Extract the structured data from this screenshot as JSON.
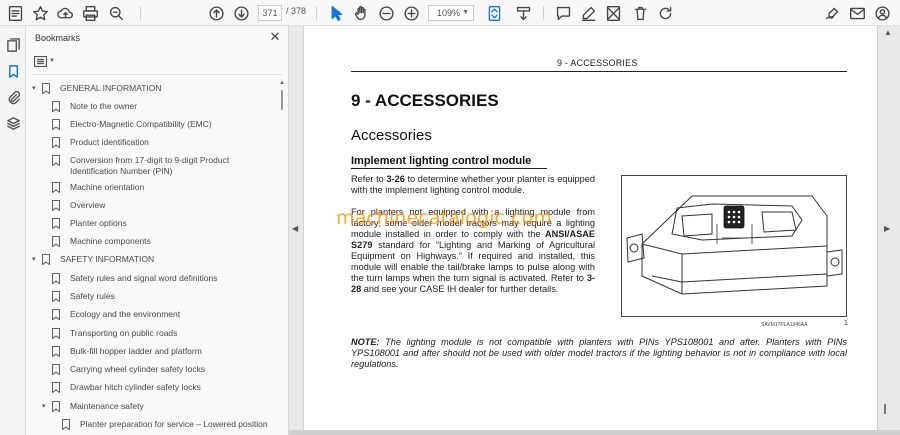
{
  "toolbar": {
    "page_current": "371",
    "page_total": "/ 378",
    "zoom": "109%"
  },
  "panel": {
    "title": "Bookmarks",
    "close": "✕",
    "items": [
      {
        "label": "GENERAL INFORMATION",
        "expanded": true
      },
      {
        "label": "Note to the owner"
      },
      {
        "label": "Electro-Magnetic Compatibility (EMC)"
      },
      {
        "label": "Product identification"
      },
      {
        "label": "Conversion from 17-digit to 9-digit Product Identification Number (PIN)"
      },
      {
        "label": "Machine orientation"
      },
      {
        "label": "Overview"
      },
      {
        "label": "Planter options"
      },
      {
        "label": "Machine components"
      },
      {
        "label": "SAFETY INFORMATION",
        "expanded": true
      },
      {
        "label": "Safety rules and signal word definitions"
      },
      {
        "label": "Safety rules"
      },
      {
        "label": "Ecology and the environment"
      },
      {
        "label": "Transporting on public roads"
      },
      {
        "label": "Bulk-fill hopper ladder and platform"
      },
      {
        "label": "Carrying wheel cylinder safety locks"
      },
      {
        "label": "Drawbar hitch cylinder safety locks"
      },
      {
        "label": "Maintenance safety",
        "expanded": true
      },
      {
        "label": "Planter preparation for service – Lowered position"
      }
    ]
  },
  "document": {
    "header": "9 - ACCESSORIES",
    "chapter_title": "9 - ACCESSORIES",
    "section_title": "Accessories",
    "subsection_title": "Implement lighting control module",
    "para1_a": "Refer to ",
    "para1_ref": "3-26",
    "para1_b": " to determine whether your planter is equipped with the implement lighting control module.",
    "para2_a": "For planters not equipped with a lighting module from factory, some older model tractors may require a lighting module installed in order to comply with the ",
    "para2_std": "ANSI/ASAE S279",
    "para2_b": " standard for “Lighting and Marking of Agricultural Equipment on Highways.” If required and installed, this module will enable the tail/brake lamps to pulse along with the turn lamps when the turn signal is activated. Refer to ",
    "para2_ref": "3-28",
    "para2_c": " and see your CASE IH dealer for further details.",
    "note_label": "NOTE:",
    "note_text": " The lighting module is not compatible with planters with PINs YPS108001 and after. Planters with PINs YPS108001 and after should not be used with older model tractors if the lighting behavior is not in compliance with local regulations.",
    "figure_caption": "SAVM17PLA1346AA",
    "figure_number": "1",
    "watermark": "machinecatalogic.com"
  }
}
